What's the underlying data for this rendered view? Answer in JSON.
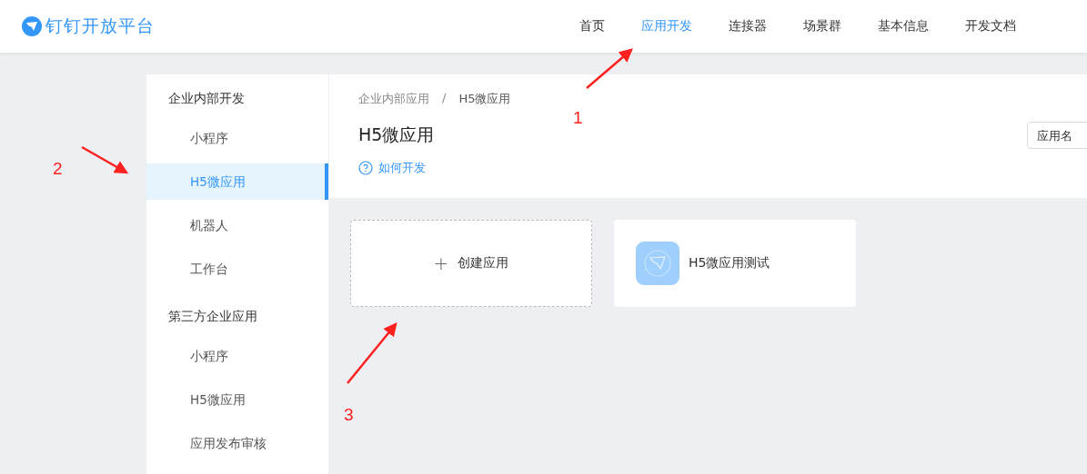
{
  "header": {
    "logo": "钉钉开放平台",
    "nav": [
      {
        "label": "首页",
        "selected": false
      },
      {
        "label": "应用开发",
        "selected": true
      },
      {
        "label": "连接器",
        "selected": false
      },
      {
        "label": "场景群",
        "selected": false
      },
      {
        "label": "基本信息",
        "selected": false
      },
      {
        "label": "开发文档",
        "selected": false
      }
    ]
  },
  "sidebar": {
    "groups": [
      {
        "title": "企业内部开发",
        "items": [
          {
            "label": "小程序",
            "selected": false
          },
          {
            "label": "H5微应用",
            "selected": true
          },
          {
            "label": "机器人",
            "selected": false
          },
          {
            "label": "工作台",
            "selected": false
          }
        ]
      },
      {
        "title": "第三方企业应用",
        "items": [
          {
            "label": "小程序",
            "selected": false
          },
          {
            "label": "H5微应用",
            "selected": false
          },
          {
            "label": "应用发布审核",
            "selected": false
          }
        ]
      }
    ]
  },
  "main": {
    "breadcrumb": [
      "企业内部应用",
      "H5微应用"
    ],
    "breadcrumb_separator": "/",
    "title": "H5微应用",
    "help_link": "如何开发",
    "search": {
      "placeholder": "应用名"
    },
    "cards": [
      {
        "kind": "create",
        "label": "创建应用",
        "icon_text": "+"
      },
      {
        "kind": "app",
        "label": "H5微应用测试"
      }
    ]
  },
  "annotations": [
    {
      "label": "1"
    },
    {
      "label": "2"
    },
    {
      "label": "3"
    }
  ]
}
